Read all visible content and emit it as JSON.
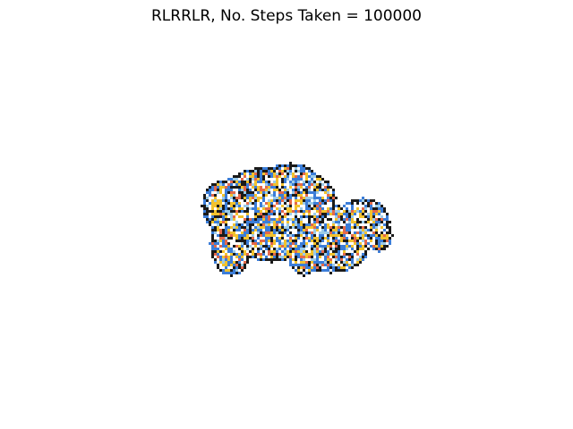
{
  "figure": {
    "title": "RLRRLR, No. Steps Taken = 100000"
  },
  "ant_grid": {
    "rule": "RLRRLR",
    "steps": 100000,
    "colors": [
      "#ffffff",
      "#1a1a1a",
      "#3b7dd8",
      "#f2c22e",
      "#e4694a",
      "#9ccbe8"
    ],
    "background": "#ffffff",
    "axes_visible": false,
    "seed": 7
  }
}
